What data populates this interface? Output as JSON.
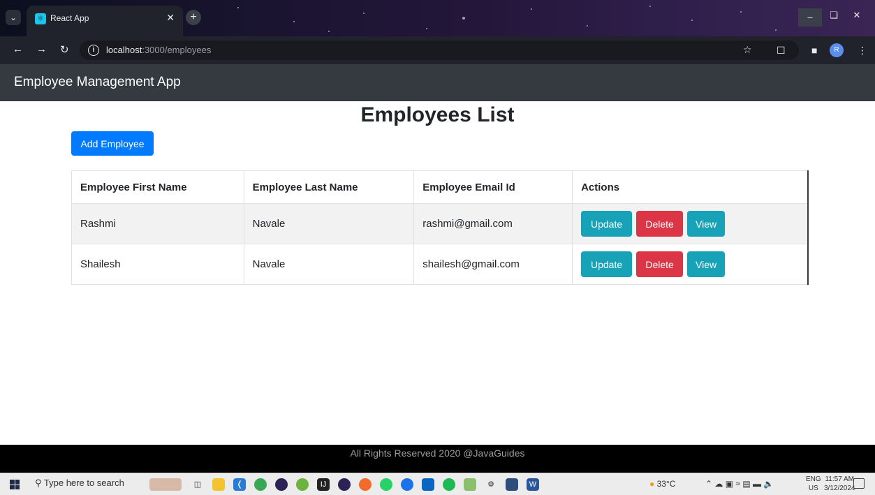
{
  "browser": {
    "tab_title": "React App",
    "url_host": "localhost",
    "url_path": ":3000/employees",
    "profile_initial": "R"
  },
  "navbar": {
    "brand": "Employee Management App"
  },
  "main": {
    "title": "Employees List",
    "add_button": "Add Employee",
    "table": {
      "headers": [
        "Employee First Name",
        "Employee Last Name",
        "Employee Email Id",
        "Actions"
      ],
      "rows": [
        {
          "first_name": "Rashmi",
          "last_name": "Navale",
          "email": "rashmi@gmail.com"
        },
        {
          "first_name": "Shailesh",
          "last_name": "Navale",
          "email": "shailesh@gmail.com"
        }
      ],
      "actions": {
        "update": "Update",
        "delete": "Delete",
        "view": "View"
      }
    }
  },
  "footer": {
    "text": "All Rights Reserved 2020 @JavaGuides"
  },
  "taskbar": {
    "search_placeholder": "Type here to search",
    "weather": "33°C",
    "lang_line1": "ENG",
    "lang_line2": "US",
    "time": "11:57 AM",
    "date": "3/12/2024"
  },
  "colors": {
    "navbar": "#343a40",
    "primary": "#007bff",
    "info": "#17a2b8",
    "danger": "#dc3545",
    "footer": "#000000"
  }
}
